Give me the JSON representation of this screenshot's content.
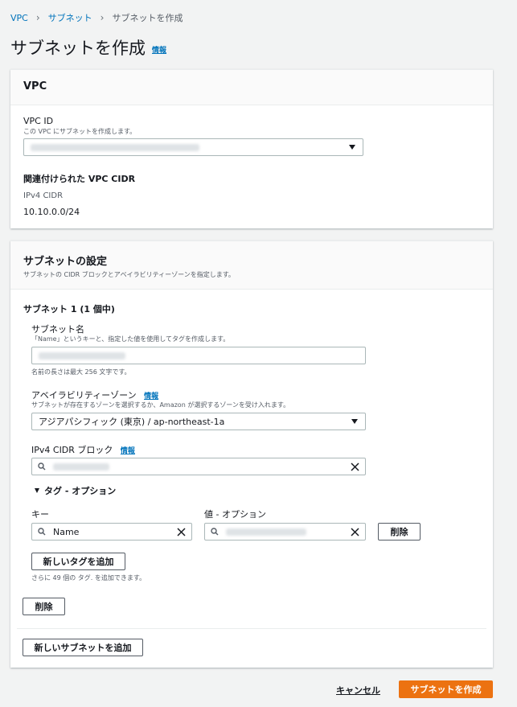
{
  "breadcrumb": {
    "items": [
      "VPC",
      "サブネット"
    ],
    "current": "サブネットを作成"
  },
  "page": {
    "title": "サブネットを作成",
    "info": "情報"
  },
  "vpc_section": {
    "title": "VPC",
    "vpc_id_label": "VPC ID",
    "vpc_id_desc": "この VPC にサブネットを作成します。",
    "cidr_heading": "関連付けられた VPC CIDR",
    "ipv4_label": "IPv4 CIDR",
    "ipv4_value": "10.10.0.0/24"
  },
  "subnet_section": {
    "title": "サブネットの設定",
    "desc": "サブネットの CIDR ブロックとアベイラビリティーゾーンを指定します。",
    "subnet_heading": "サブネット 1 (1 個中)",
    "name_label": "サブネット名",
    "name_desc": "「Name」というキーと、指定した値を使用してタグを作成します。",
    "name_hint": "名前の長さは最大 256 文字です。",
    "az_label": "アベイラビリティーゾーン",
    "az_info": "情報",
    "az_desc": "サブネットが存在するゾーンを選択するか、Amazon が選択するゾーンを受け入れます。",
    "az_value": "アジアパシフィック (東京) / ap-northeast-1a",
    "cidr_label": "IPv4 CIDR ブロック",
    "cidr_info": "情報",
    "tags_toggle": "タグ - オプション",
    "key_label": "キー",
    "value_label": "値 - オプション",
    "key_value": "Name",
    "remove_tag_button": "削除",
    "add_tag_button": "新しいタグを追加",
    "tags_remaining": "さらに 49 個の タグ. を追加できます。",
    "remove_subnet_button": "削除",
    "add_subnet_button": "新しいサブネットを追加"
  },
  "footer": {
    "cancel": "キャンセル",
    "create": "サブネットを作成"
  },
  "colors": {
    "link": "#0073bb",
    "primary": "#ec7211",
    "background": "#f2f3f3"
  },
  "icons": [
    "chevron-right-icon",
    "caret-down-icon",
    "search-icon",
    "clear-icon",
    "triangle-down-icon"
  ]
}
